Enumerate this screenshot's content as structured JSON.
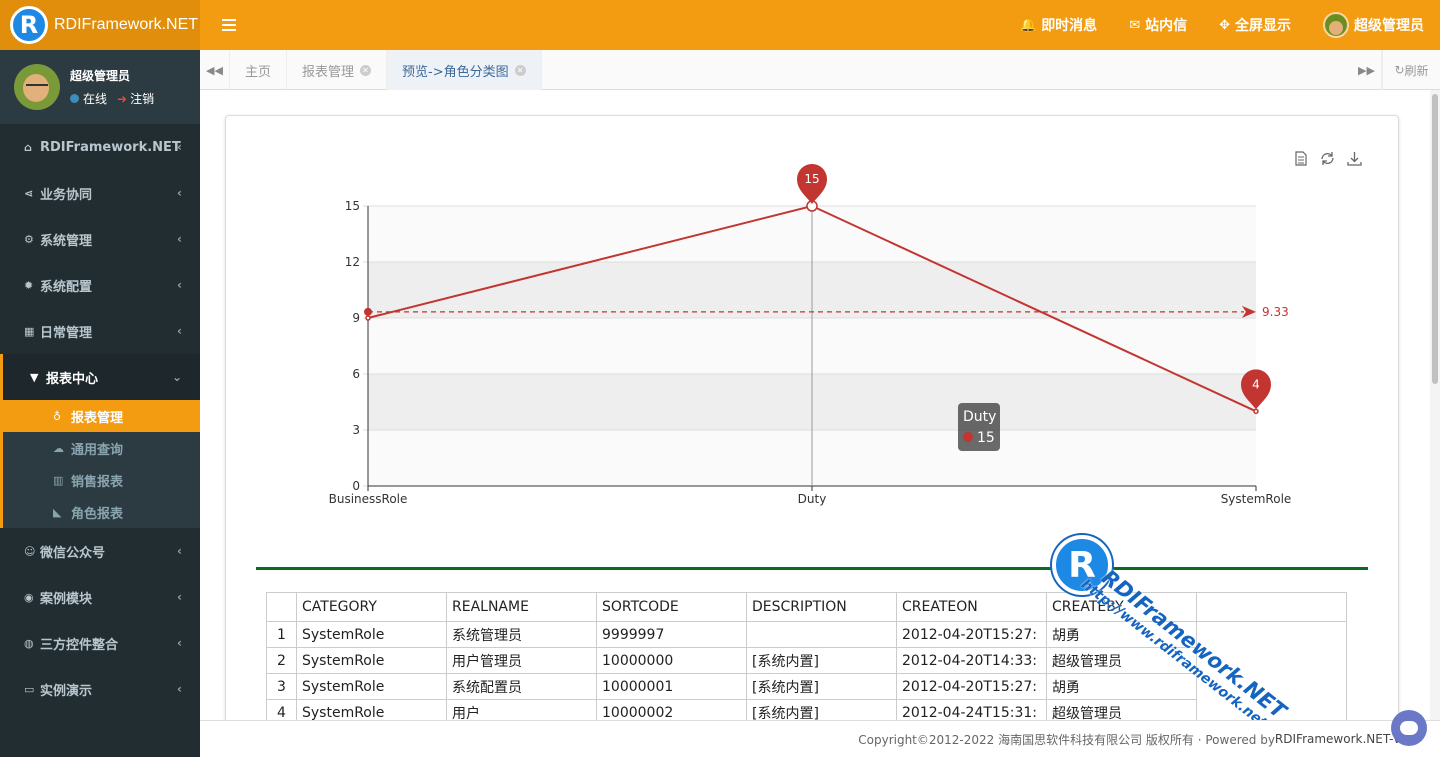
{
  "app": {
    "logo_letter": "R",
    "title": "RDIFramework.NET"
  },
  "topbar": {
    "items": [
      {
        "icon": "bell-icon",
        "label": "即时消息"
      },
      {
        "icon": "envelope-icon",
        "label": "站内信"
      },
      {
        "icon": "fullscreen-icon",
        "label": "全屏显示"
      }
    ],
    "user_label": "超级管理员"
  },
  "user_panel": {
    "name": "超级管理员",
    "status": "在线",
    "logout": "注销"
  },
  "sidebar": {
    "items": [
      {
        "icon": "home-icon",
        "label": "RDIFramework.NET"
      },
      {
        "icon": "share-icon",
        "label": "业务协同"
      },
      {
        "icon": "cogs-icon",
        "label": "系统管理"
      },
      {
        "icon": "gear-icon",
        "label": "系统配置"
      },
      {
        "icon": "calendar-icon",
        "label": "日常管理"
      },
      {
        "icon": "filter-icon",
        "label": "报表中心"
      },
      {
        "icon": "wechat-icon",
        "label": "微信公众号"
      },
      {
        "icon": "eye-icon",
        "label": "案例模块"
      },
      {
        "icon": "globe-icon",
        "label": "三方控件整合"
      },
      {
        "icon": "desktop-icon",
        "label": "实例演示"
      }
    ],
    "submenu": [
      {
        "icon": "stethoscope-icon",
        "label": "报表管理"
      },
      {
        "icon": "cloud-icon",
        "label": "通用查询"
      },
      {
        "icon": "bar-chart-icon",
        "label": "销售报表"
      },
      {
        "icon": "area-chart-icon",
        "label": "角色报表"
      }
    ]
  },
  "tabs": {
    "items": [
      {
        "label": "主页"
      },
      {
        "label": "报表管理"
      },
      {
        "label": "预览->角色分类图"
      }
    ],
    "refresh": "刷新"
  },
  "chart_data": {
    "type": "line",
    "categories": [
      "BusinessRole",
      "Duty",
      "SystemRole"
    ],
    "series": [
      {
        "name": "",
        "values": [
          9,
          15,
          4
        ]
      }
    ],
    "ylim": [
      0,
      15
    ],
    "yticks": [
      0,
      3,
      6,
      9,
      12,
      15
    ],
    "mark_points": [
      {
        "label": "15",
        "value": 15,
        "category": "Duty"
      },
      {
        "label": "4",
        "value": 4,
        "category": "SystemRole"
      }
    ],
    "mark_line": {
      "value": 9.33,
      "label": "9.33"
    },
    "tooltip": {
      "title": "Duty",
      "value": "15"
    },
    "grid": true,
    "color": "#c23531"
  },
  "table": {
    "headers": [
      "",
      "CATEGORY",
      "REALNAME",
      "SORTCODE",
      "DESCRIPTION",
      "CREATEON",
      "CREATEBY"
    ],
    "rows": [
      [
        "1",
        "SystemRole",
        "系统管理员",
        "9999997",
        "",
        "2012-04-20T15:27:",
        "胡勇"
      ],
      [
        "2",
        "SystemRole",
        "用户管理员",
        "10000000",
        "[系统内置]",
        "2012-04-20T14:33:",
        "超级管理员"
      ],
      [
        "3",
        "SystemRole",
        "系统配置员",
        "10000001",
        "[系统内置]",
        "2012-04-20T15:27:",
        "胡勇"
      ],
      [
        "4",
        "SystemRole",
        "用户",
        "10000002",
        "[系统内置]",
        "2012-04-24T15:31:",
        "超级管理员"
      ]
    ]
  },
  "watermark": {
    "letter": "R",
    "line1": "RDIFramework.NET",
    "line2": "http://www.rdiframework.net"
  },
  "footer": {
    "text": "Copyright©2012-2022 海南国思软件科技有限公司 版权所有 · Powered by ",
    "brand": "RDIFramework.NET-V5.0"
  }
}
